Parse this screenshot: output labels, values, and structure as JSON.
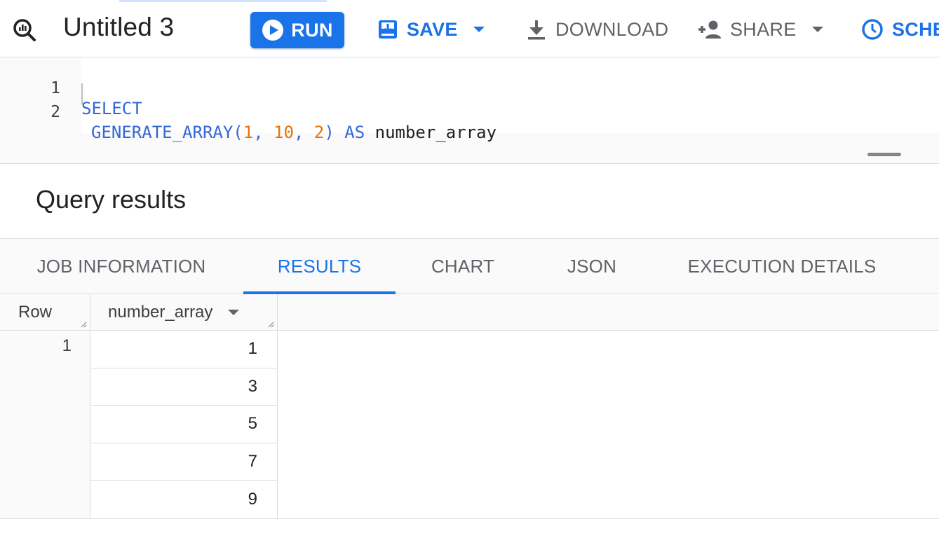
{
  "toolbar": {
    "tab_title": "Untitled 3",
    "run_label": "RUN",
    "save_label": "SAVE",
    "download_label": "DOWNLOAD",
    "share_label": "SHARE",
    "schedule_label": "SCHE",
    "accent_color": "#1a73e8",
    "icons": [
      "query-icon",
      "play-icon",
      "save-icon",
      "download-icon",
      "person-add-icon",
      "clock-icon"
    ]
  },
  "editor": {
    "lines": [
      {
        "number": "1",
        "tokens": [
          {
            "text": "SELECT",
            "kind": "kw"
          }
        ]
      },
      {
        "number": "2",
        "tokens": [
          {
            "text": "GENERATE_ARRAY(",
            "kind": "kw"
          },
          {
            "text": "1",
            "kind": "num"
          },
          {
            "text": ", ",
            "kind": "kw"
          },
          {
            "text": "10",
            "kind": "num"
          },
          {
            "text": ", ",
            "kind": "kw"
          },
          {
            "text": "2",
            "kind": "num"
          },
          {
            "text": ") AS ",
            "kind": "kw"
          },
          {
            "text": "number_array",
            "kind": "plain"
          }
        ]
      }
    ]
  },
  "results": {
    "title": "Query results",
    "tabs": [
      {
        "label": "JOB INFORMATION",
        "active": false
      },
      {
        "label": "RESULTS",
        "active": true
      },
      {
        "label": "CHART",
        "active": false
      },
      {
        "label": "JSON",
        "active": false
      },
      {
        "label": "EXECUTION DETAILS",
        "active": false
      }
    ],
    "table": {
      "row_header": "Row",
      "column_header": "number_array",
      "row_number": "1",
      "values": [
        "1",
        "3",
        "5",
        "7",
        "9"
      ]
    }
  }
}
